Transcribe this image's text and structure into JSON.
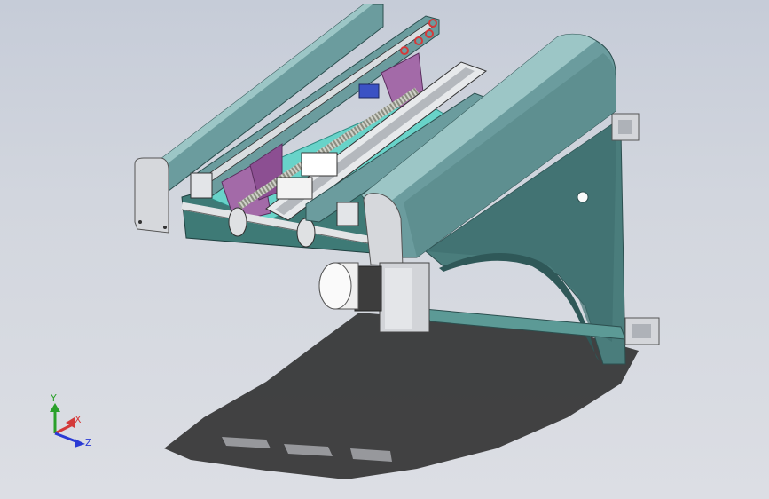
{
  "view": {
    "background_top": "#c6ccd8",
    "background_bottom": "#dcdee4"
  },
  "model": {
    "frame_color": "#6b9c9e",
    "frame_dark": "#3f6f6f",
    "end_cap_color": "#d6d8dc",
    "bracket_color": "#a36aa8",
    "plate_color": "#64d0c8",
    "rail_color": "#d9dde0",
    "motor_color": "#e8e8e8",
    "shadow_color": "#2b2b2b"
  },
  "triad": {
    "x_label": "X",
    "y_label": "Y",
    "z_label": "Z",
    "x_color": "#d43a3a",
    "y_color": "#2aa02a",
    "z_color": "#2a3ad4"
  }
}
